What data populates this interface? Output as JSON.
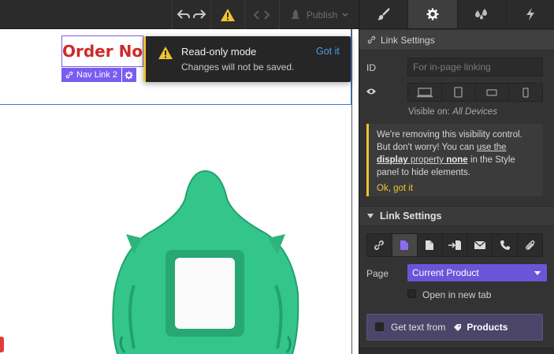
{
  "toolbar": {
    "undo_icon": "undo-icon",
    "redo_icon": "redo-icon",
    "warning_icon": "warning-icon",
    "code_icon": "code-icon",
    "publish_label": "Publish",
    "colors": {
      "warning": "#f1c232",
      "background": "#2b2b2b"
    }
  },
  "panel": {
    "tabs": [
      {
        "name": "style",
        "icon": "brush-icon"
      },
      {
        "name": "settings",
        "icon": "gear-icon",
        "active": true
      },
      {
        "name": "style-manager",
        "icon": "drops-icon"
      },
      {
        "name": "interactions",
        "icon": "lightning-icon"
      }
    ],
    "section_title": "Link Settings",
    "id_label": "ID",
    "id_placeholder": "For in-page linking",
    "visible_on_label": "Visible on:",
    "visible_on_value": "All Devices",
    "notice": {
      "line1": "We're removing this visibility control.",
      "line2_pre": "But don't worry! You can ",
      "line2_link": "use the",
      "line3_bold1": "display",
      "line3_mid": " property ",
      "line3_bold2": "none",
      "line3_post": " in the Style",
      "line4": "panel to hide elements.",
      "ok": "Ok, got it"
    },
    "link_settings_title": "Link Settings",
    "page_label": "Page",
    "page_value": "Current Product",
    "new_tab_label": "Open in new tab",
    "get_text_label": "Get text from",
    "get_text_source": "Products",
    "accent": "#6c54d9"
  },
  "canvas": {
    "order_now": "Order Now",
    "nav_tag": "Nav Link 2",
    "toast": {
      "title": "Read-only mode",
      "subtitle": "Changes will not be saved.",
      "button": "Got it"
    }
  }
}
